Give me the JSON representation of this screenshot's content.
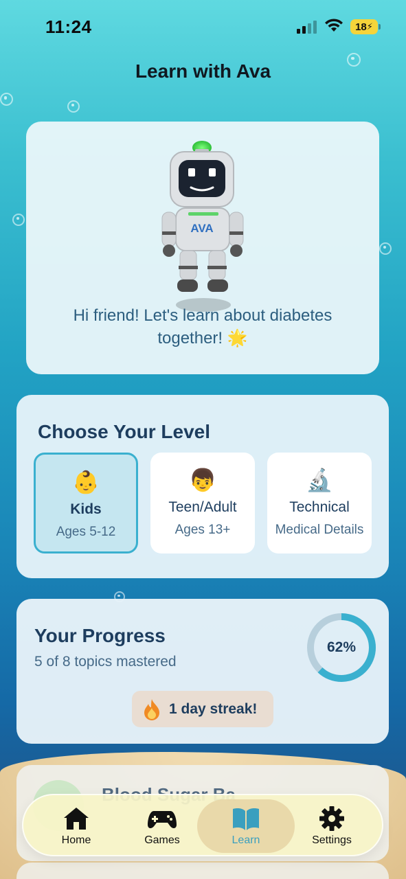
{
  "status_bar": {
    "time": "11:24",
    "battery": "18"
  },
  "header": {
    "title": "Learn with Ava"
  },
  "mascot": {
    "badge_text": "AVA",
    "greeting": "Hi friend! Let's learn about diabetes together! 🌟"
  },
  "level": {
    "title": "Choose Your Level",
    "options": [
      {
        "emoji": "👶",
        "name": "Kids",
        "subtitle": "Ages 5-12",
        "selected": true
      },
      {
        "emoji": "👦",
        "name": "Teen/Adult",
        "subtitle": "Ages 13+",
        "selected": false
      },
      {
        "emoji": "🔬",
        "name": "Technical",
        "subtitle": "Medical Details",
        "selected": false
      }
    ]
  },
  "progress": {
    "title": "Your Progress",
    "subtitle": "5 of 8 topics mastered",
    "percent_label": "62%",
    "percent": 62,
    "streak_label": "1 day streak!"
  },
  "next_card": {
    "title": "Blood Sugar Ba"
  },
  "nav": {
    "items": [
      {
        "label": "Home",
        "icon": "home-icon",
        "active": false
      },
      {
        "label": "Games",
        "icon": "gamepad-icon",
        "active": false
      },
      {
        "label": "Learn",
        "icon": "book-icon",
        "active": true
      },
      {
        "label": "Settings",
        "icon": "gear-icon",
        "active": false
      }
    ]
  },
  "colors": {
    "accent": "#3ab0cf",
    "ring_track": "#b7cfdc",
    "nav_bg": "#f8f4c8",
    "title_text": "#1d3d5e"
  }
}
